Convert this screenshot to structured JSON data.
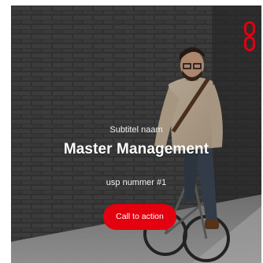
{
  "hero": {
    "subtitle": "Subtitel naam",
    "title": "Master Management",
    "usp": "usp nummer #1",
    "cta_label": "Call to action"
  },
  "brand": {
    "accent_color": "#e3000f",
    "logo_icon": "brand-logo-icon"
  }
}
